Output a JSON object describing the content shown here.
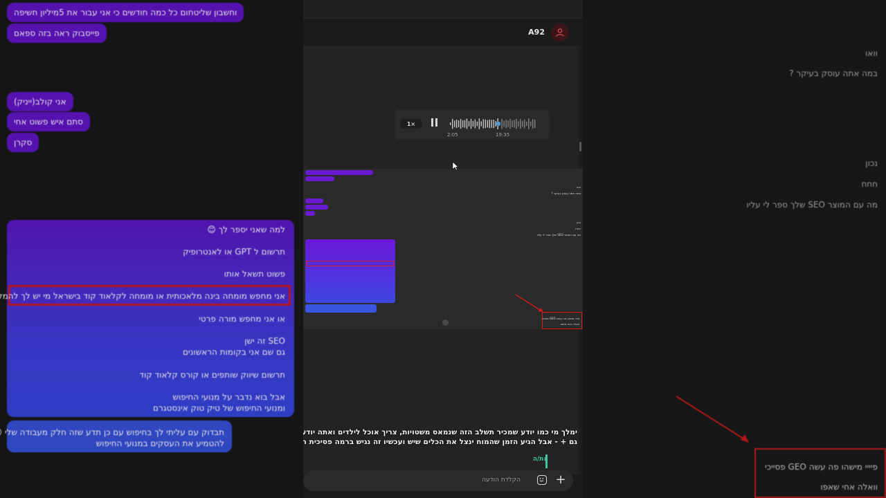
{
  "left_panel": {
    "top_line": "וחשבון שליטחום כל כמה חודשים כי אני עבור את 5מיליון חשיפה",
    "fb_line": "פייסבוק ראה בזה ספאם",
    "lines_small": [
      "אני קולב(ייניק)",
      "סתם איש פשוט אחי",
      "סקרן"
    ],
    "block_lines": [
      "למה שאני יספר לך 😊",
      "תרשום ל GPT או לאנטרופיק",
      "פשוט תשאל אותו",
      "אני מחפש מומחה בינה מלאכותית או מומחה לקלאוד קוד בישראל מי יש לך להמליץ לי",
      "או אני מחפש מורה פרטי",
      "SEO זה ישן",
      "גם שם אני בקומות הראשונים",
      "תרשום שיווק שותפים או  קורס קלאוד קוד",
      "אבל בוא נדבר על מנועי החיפוש",
      "ומנועי החיפוש של טיק טוק אינסטגרם"
    ],
    "last_bubble_1": "תבדוק עם עליתי לך בחיפוש עם כן תדע שזה חלק מעבודה שלי 😊",
    "last_bubble_2": "להטמיע את העסקים במנועי החיפוש"
  },
  "right_panel": {
    "lines": [
      "וואו",
      "במה אתה עוסק בעיקר ?",
      "נכון",
      "חחח",
      "מה עם המוצר SEO שלך ספר לי עליו"
    ],
    "box_line_1": "פיייי מישהו פה עשה GEO פסייכי",
    "box_line_2": "וואלה אחי שאפו"
  },
  "chat": {
    "contact_name": "A92",
    "player": {
      "speed": "1×",
      "elapsed": "2:05",
      "total": "19:35",
      "progress": 0.56
    },
    "caption_line_1": "ימלך מי כמו יודע שמכיר תשלב הזה שנמאס משטויות, צריך אוכל לילדים ואתה יודע מה אתה שווה",
    "caption_line_2": "גם + - אבל הגיע הזמן שהמוח ינצל את הכלים שיש ועכשיו זה נגיש ברמה פסיכית רק צריך לדעת",
    "reply_text": "את/ה",
    "compose_placeholder": "הקלדת הודעה"
  },
  "colors": {
    "purple": "#5a12b8",
    "blue": "#3550dd",
    "highlight_red": "#c0151e",
    "reply_green": "#3fc6a0"
  }
}
